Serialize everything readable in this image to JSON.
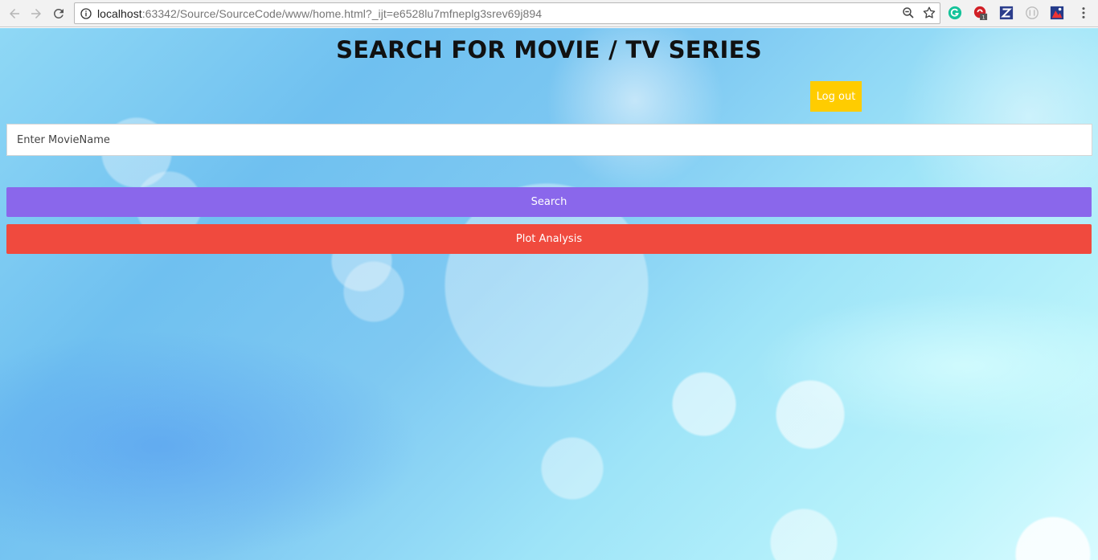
{
  "browser": {
    "url_host": "localhost",
    "url_rest": ":63342/Source/SourceCode/www/home.html?_ijt=e6528lu7mfneplg3srev69j894",
    "extension_badge": "1"
  },
  "page": {
    "title": "SEARCH FOR MOVIE / TV SERIES",
    "logout_label": "Log out",
    "movie_input_placeholder": "Enter MovieName",
    "search_label": "Search",
    "plot_analysis_label": "Plot Analysis"
  },
  "colors": {
    "logout": "#ffcc00",
    "search": "#8a67eb",
    "plot_analysis": "#f04a3e"
  }
}
